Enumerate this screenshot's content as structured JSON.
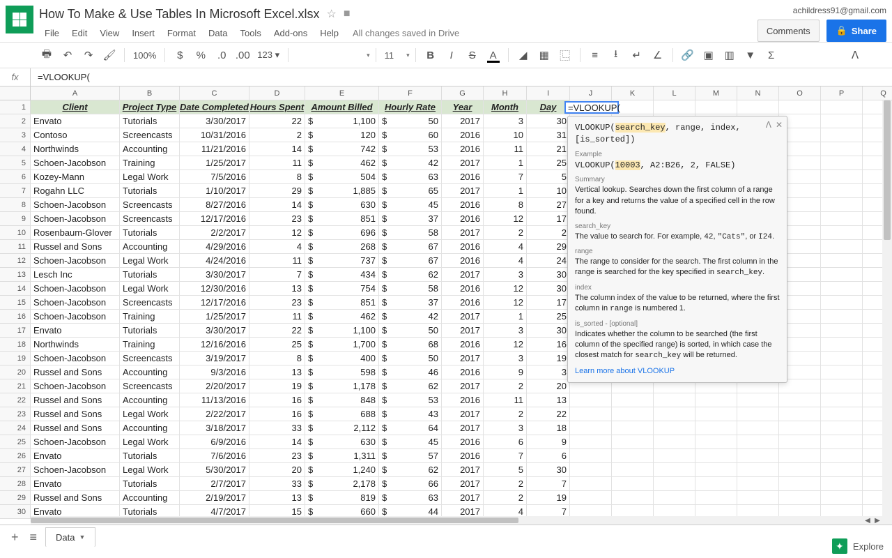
{
  "header": {
    "doc_title": "How To Make & Use Tables In Microsoft Excel.xlsx",
    "user_email": "achildress91@gmail.com",
    "comments_btn": "Comments",
    "share_btn": "Share",
    "save_status": "All changes saved in Drive"
  },
  "menus": [
    "File",
    "Edit",
    "View",
    "Insert",
    "Format",
    "Data",
    "Tools",
    "Add-ons",
    "Help"
  ],
  "toolbar": {
    "zoom": "100%",
    "format_more": "123",
    "font": "",
    "font_size": "11"
  },
  "formula_bar": {
    "fx": "fx",
    "value": "=VLOOKUP("
  },
  "columns": [
    "A",
    "B",
    "C",
    "D",
    "E",
    "F",
    "G",
    "H",
    "I",
    "J",
    "K",
    "L",
    "M",
    "N",
    "O",
    "P",
    "Q",
    "C"
  ],
  "headers": [
    "Client",
    "Project Type",
    "Date Completed",
    "Hours Spent",
    "Amount Billed",
    "Hourly Rate",
    "Year",
    "Month",
    "Day"
  ],
  "rows": [
    [
      "Envato",
      "Tutorials",
      "3/30/2017",
      "22",
      "1,100",
      "50",
      "2017",
      "3",
      "30"
    ],
    [
      "Contoso",
      "Screencasts",
      "10/31/2016",
      "2",
      "120",
      "60",
      "2016",
      "10",
      "31"
    ],
    [
      "Northwinds",
      "Accounting",
      "11/21/2016",
      "14",
      "742",
      "53",
      "2016",
      "11",
      "21"
    ],
    [
      "Schoen-Jacobson",
      "Training",
      "1/25/2017",
      "11",
      "462",
      "42",
      "2017",
      "1",
      "25"
    ],
    [
      "Kozey-Mann",
      "Legal Work",
      "7/5/2016",
      "8",
      "504",
      "63",
      "2016",
      "7",
      "5"
    ],
    [
      "Rogahn LLC",
      "Tutorials",
      "1/10/2017",
      "29",
      "1,885",
      "65",
      "2017",
      "1",
      "10"
    ],
    [
      "Schoen-Jacobson",
      "Screencasts",
      "8/27/2016",
      "14",
      "630",
      "45",
      "2016",
      "8",
      "27"
    ],
    [
      "Schoen-Jacobson",
      "Screencasts",
      "12/17/2016",
      "23",
      "851",
      "37",
      "2016",
      "12",
      "17"
    ],
    [
      "Rosenbaum-Glover",
      "Tutorials",
      "2/2/2017",
      "12",
      "696",
      "58",
      "2017",
      "2",
      "2"
    ],
    [
      "Russel and Sons",
      "Accounting",
      "4/29/2016",
      "4",
      "268",
      "67",
      "2016",
      "4",
      "29"
    ],
    [
      "Schoen-Jacobson",
      "Legal Work",
      "4/24/2016",
      "11",
      "737",
      "67",
      "2016",
      "4",
      "24"
    ],
    [
      "Lesch Inc",
      "Tutorials",
      "3/30/2017",
      "7",
      "434",
      "62",
      "2017",
      "3",
      "30"
    ],
    [
      "Schoen-Jacobson",
      "Legal Work",
      "12/30/2016",
      "13",
      "754",
      "58",
      "2016",
      "12",
      "30"
    ],
    [
      "Schoen-Jacobson",
      "Screencasts",
      "12/17/2016",
      "23",
      "851",
      "37",
      "2016",
      "12",
      "17"
    ],
    [
      "Schoen-Jacobson",
      "Training",
      "1/25/2017",
      "11",
      "462",
      "42",
      "2017",
      "1",
      "25"
    ],
    [
      "Envato",
      "Tutorials",
      "3/30/2017",
      "22",
      "1,100",
      "50",
      "2017",
      "3",
      "30"
    ],
    [
      "Northwinds",
      "Training",
      "12/16/2016",
      "25",
      "1,700",
      "68",
      "2016",
      "12",
      "16"
    ],
    [
      "Schoen-Jacobson",
      "Screencasts",
      "3/19/2017",
      "8",
      "400",
      "50",
      "2017",
      "3",
      "19"
    ],
    [
      "Russel and Sons",
      "Accounting",
      "9/3/2016",
      "13",
      "598",
      "46",
      "2016",
      "9",
      "3"
    ],
    [
      "Schoen-Jacobson",
      "Screencasts",
      "2/20/2017",
      "19",
      "1,178",
      "62",
      "2017",
      "2",
      "20"
    ],
    [
      "Russel and Sons",
      "Accounting",
      "11/13/2016",
      "16",
      "848",
      "53",
      "2016",
      "11",
      "13"
    ],
    [
      "Russel and Sons",
      "Legal Work",
      "2/22/2017",
      "16",
      "688",
      "43",
      "2017",
      "2",
      "22"
    ],
    [
      "Russel and Sons",
      "Accounting",
      "3/18/2017",
      "33",
      "2,112",
      "64",
      "2017",
      "3",
      "18"
    ],
    [
      "Schoen-Jacobson",
      "Legal Work",
      "6/9/2016",
      "14",
      "630",
      "45",
      "2016",
      "6",
      "9"
    ],
    [
      "Envato",
      "Tutorials",
      "7/6/2016",
      "23",
      "1,311",
      "57",
      "2016",
      "7",
      "6"
    ],
    [
      "Schoen-Jacobson",
      "Legal Work",
      "5/30/2017",
      "20",
      "1,240",
      "62",
      "2017",
      "5",
      "30"
    ],
    [
      "Envato",
      "Tutorials",
      "2/7/2017",
      "33",
      "2,178",
      "66",
      "2017",
      "2",
      "7"
    ],
    [
      "Russel and Sons",
      "Accounting",
      "2/19/2017",
      "13",
      "819",
      "63",
      "2017",
      "2",
      "19"
    ],
    [
      "Envato",
      "Tutorials",
      "4/7/2017",
      "15",
      "660",
      "44",
      "2017",
      "4",
      "7"
    ]
  ],
  "active_cell": {
    "value": "=VLOOKUP("
  },
  "tooltip": {
    "sig_pre": "VLOOKUP(",
    "sig_hl": "search_key",
    "sig_post": ", range, index, [is_sorted])",
    "example_label": "Example",
    "example_pre": "VLOOKUP(",
    "example_hl": "10003",
    "example_post": ", A2:B26, 2, FALSE)",
    "summary_label": "Summary",
    "summary_text": "Vertical lookup. Searches down the first column of a range for a key and returns the value of a specified cell in the row found.",
    "p1_label": "search_key",
    "p1_text_a": "The value to search for. For example, ",
    "p1_text_b": "42",
    "p1_text_c": ", ",
    "p1_text_d": "\"Cats\"",
    "p1_text_e": ", or ",
    "p1_text_f": "I24",
    "p1_text_g": ".",
    "p2_label": "range",
    "p2_text_a": "The range to consider for the search. The first column in the range is searched for the key specified in ",
    "p2_text_b": "search_key",
    "p2_text_c": ".",
    "p3_label": "index",
    "p3_text_a": "The column index of the value to be returned, where the first column in ",
    "p3_text_b": "range",
    "p3_text_c": " is numbered 1.",
    "p4_label": "is_sorted - [optional]",
    "p4_text_a": "Indicates whether the column to be searched (the first column of the specified range) is sorted, in which case the closest match for ",
    "p4_text_b": "search_key",
    "p4_text_c": " will be returned.",
    "link": "Learn more about VLOOKUP"
  },
  "sheets": {
    "tab1": "Data",
    "explore": "Explore"
  }
}
